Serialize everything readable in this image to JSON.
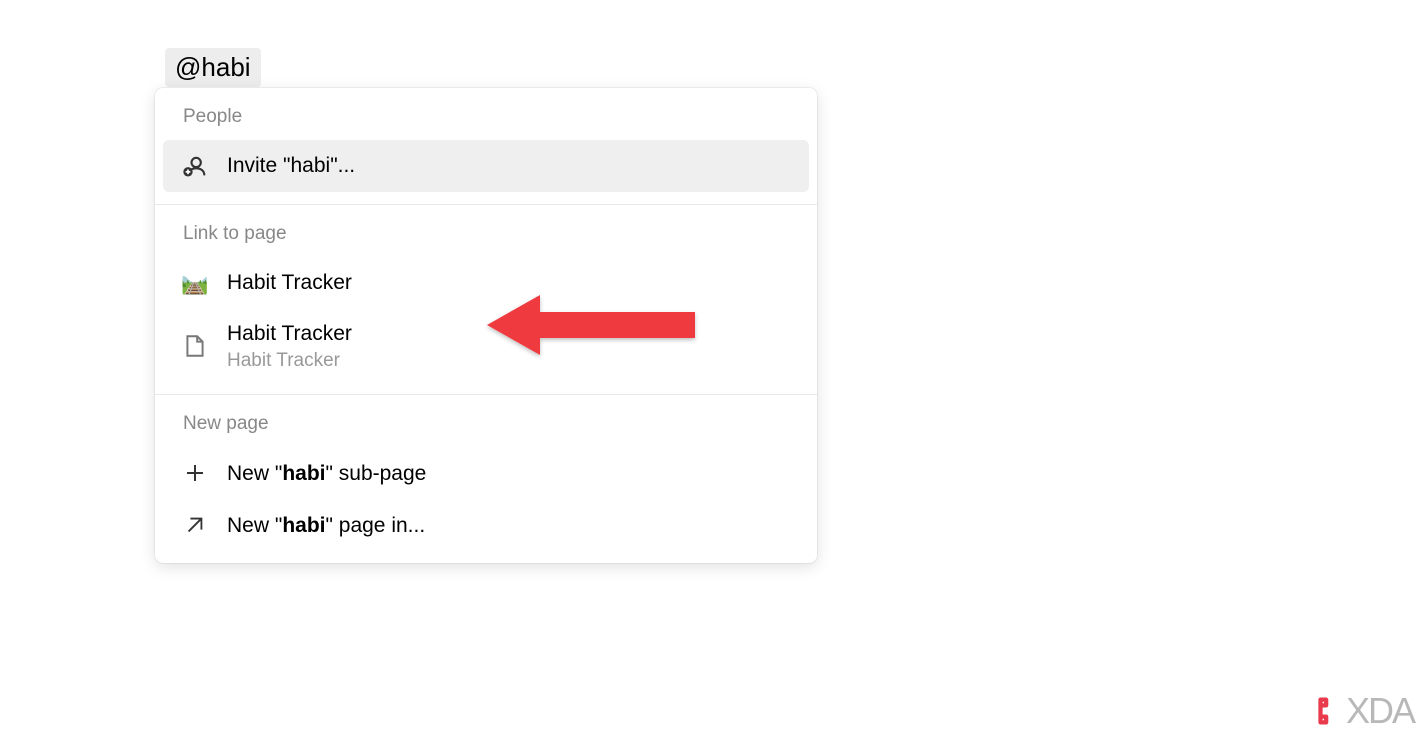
{
  "input": {
    "value": "@habi"
  },
  "dropdown": {
    "sections": {
      "people": {
        "header": "People",
        "invite_prefix": "Invite \"",
        "invite_term": "habi",
        "invite_suffix": "\"..."
      },
      "link_to_page": {
        "header": "Link to page",
        "items": [
          {
            "icon": "🛤️",
            "label": "Habit Tracker"
          },
          {
            "label": "Habit Tracker",
            "sub": "Habit Tracker"
          }
        ]
      },
      "new_page": {
        "header": "New page",
        "sub_page_prefix": "New \"",
        "sub_page_term": "habi",
        "sub_page_suffix": "\" sub-page",
        "page_in_prefix": "New \"",
        "page_in_term": "habi",
        "page_in_suffix": "\" page in..."
      }
    }
  },
  "watermark": {
    "text": "XDA"
  }
}
